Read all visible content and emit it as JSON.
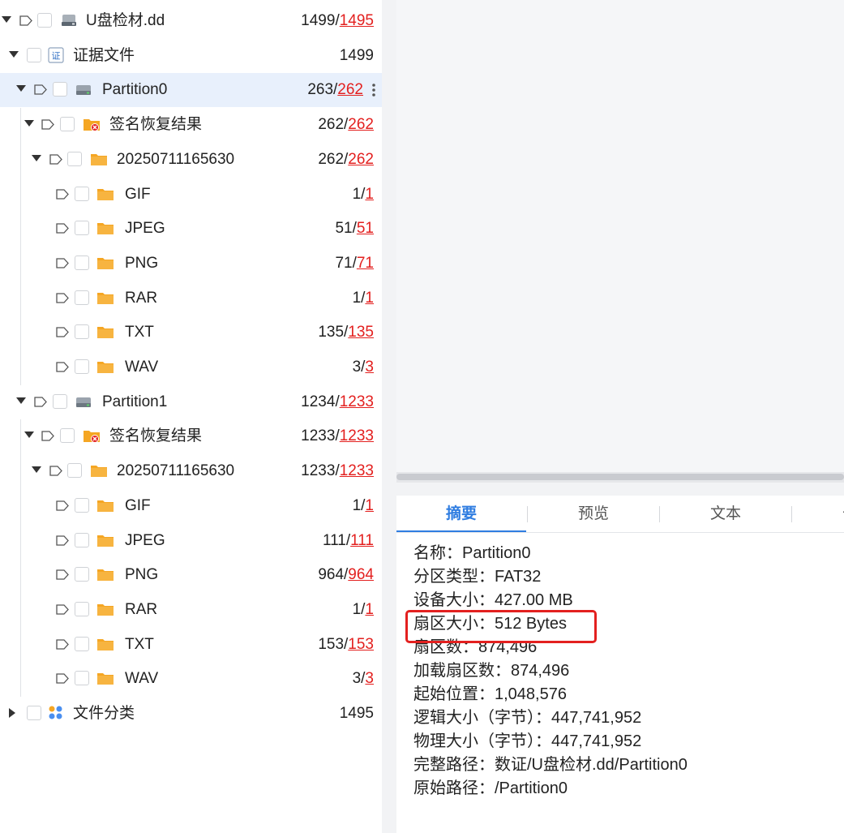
{
  "tree": [
    {
      "indent": 0,
      "caret": "down",
      "tag": true,
      "icon": "disk-image-icon",
      "label": "U盘检材.dd",
      "count": "1499/",
      "count_red": "1495",
      "selected": false,
      "kebab": false
    },
    {
      "indent": 1,
      "caret": "down",
      "tag": false,
      "icon": "evidence-icon",
      "label": "证据文件",
      "count": "1499",
      "count_red": "",
      "selected": false,
      "kebab": false
    },
    {
      "indent": 2,
      "caret": "down",
      "tag": true,
      "icon": "drive-icon",
      "label": "Partition0",
      "count": "263/",
      "count_red": "262",
      "selected": true,
      "kebab": true
    },
    {
      "indent": 3,
      "caret": "down",
      "tag": true,
      "icon": "recovery-folder-icon",
      "label": "签名恢复结果",
      "count": "262/",
      "count_red": "262",
      "selected": false,
      "kebab": false
    },
    {
      "indent": 4,
      "caret": "down",
      "tag": true,
      "icon": "folder-icon",
      "label": "20250711165630",
      "count": "262/",
      "count_red": "262",
      "selected": false,
      "kebab": false
    },
    {
      "indent": 5,
      "caret": "none",
      "tag": true,
      "icon": "folder-icon",
      "label": "GIF",
      "count": "1/",
      "count_red": "1",
      "selected": false,
      "kebab": false
    },
    {
      "indent": 5,
      "caret": "none",
      "tag": true,
      "icon": "folder-icon",
      "label": "JPEG",
      "count": "51/",
      "count_red": "51",
      "selected": false,
      "kebab": false
    },
    {
      "indent": 5,
      "caret": "none",
      "tag": true,
      "icon": "folder-icon",
      "label": "PNG",
      "count": "71/",
      "count_red": "71",
      "selected": false,
      "kebab": false
    },
    {
      "indent": 5,
      "caret": "none",
      "tag": true,
      "icon": "folder-icon",
      "label": "RAR",
      "count": "1/",
      "count_red": "1",
      "selected": false,
      "kebab": false
    },
    {
      "indent": 5,
      "caret": "none",
      "tag": true,
      "icon": "folder-icon",
      "label": "TXT",
      "count": "135/",
      "count_red": "135",
      "selected": false,
      "kebab": false
    },
    {
      "indent": 5,
      "caret": "none",
      "tag": true,
      "icon": "folder-icon",
      "label": "WAV",
      "count": "3/",
      "count_red": "3",
      "selected": false,
      "kebab": false
    },
    {
      "indent": 2,
      "caret": "down",
      "tag": true,
      "icon": "drive-icon",
      "label": "Partition1",
      "count": "1234/",
      "count_red": "1233",
      "selected": false,
      "kebab": false
    },
    {
      "indent": 3,
      "caret": "down",
      "tag": true,
      "icon": "recovery-folder-icon",
      "label": "签名恢复结果",
      "count": "1233/",
      "count_red": "1233",
      "selected": false,
      "kebab": false
    },
    {
      "indent": 4,
      "caret": "down",
      "tag": true,
      "icon": "folder-icon",
      "label": "20250711165630",
      "count": "1233/",
      "count_red": "1233",
      "selected": false,
      "kebab": false
    },
    {
      "indent": 5,
      "caret": "none",
      "tag": true,
      "icon": "folder-icon",
      "label": "GIF",
      "count": "1/",
      "count_red": "1",
      "selected": false,
      "kebab": false
    },
    {
      "indent": 5,
      "caret": "none",
      "tag": true,
      "icon": "folder-icon",
      "label": "JPEG",
      "count": "111/",
      "count_red": "111",
      "selected": false,
      "kebab": false
    },
    {
      "indent": 5,
      "caret": "none",
      "tag": true,
      "icon": "folder-icon",
      "label": "PNG",
      "count": "964/",
      "count_red": "964",
      "selected": false,
      "kebab": false
    },
    {
      "indent": 5,
      "caret": "none",
      "tag": true,
      "icon": "folder-icon",
      "label": "RAR",
      "count": "1/",
      "count_red": "1",
      "selected": false,
      "kebab": false
    },
    {
      "indent": 5,
      "caret": "none",
      "tag": true,
      "icon": "folder-icon",
      "label": "TXT",
      "count": "153/",
      "count_red": "153",
      "selected": false,
      "kebab": false
    },
    {
      "indent": 5,
      "caret": "none",
      "tag": true,
      "icon": "folder-icon",
      "label": "WAV",
      "count": "3/",
      "count_red": "3",
      "selected": false,
      "kebab": false
    },
    {
      "indent": 1,
      "caret": "right",
      "tag": false,
      "icon": "category-icon",
      "label": "文件分类",
      "count": "1495",
      "count_red": "",
      "selected": false,
      "kebab": false
    }
  ],
  "tabs": [
    "摘要",
    "预览",
    "文本",
    "十六"
  ],
  "active_tab": 0,
  "summary": [
    "名称：Partition0",
    "分区类型：FAT32",
    "设备大小：427.00 MB",
    "扇区大小：512 Bytes",
    "扇区数：874,496",
    "加载扇区数：874,496",
    "起始位置：1,048,576",
    "逻辑大小（字节）：447,741,952",
    "物理大小（字节）：447,741,952",
    "完整路径：数证/U盘检材.dd/Partition0",
    "原始路径：/Partition0"
  ],
  "highlighted_summary_line": 3,
  "colors": {
    "accent": "#2f7de1",
    "link_red": "#e3201f",
    "folder": "#f5a623",
    "selected_row": "#e8f0fc"
  }
}
